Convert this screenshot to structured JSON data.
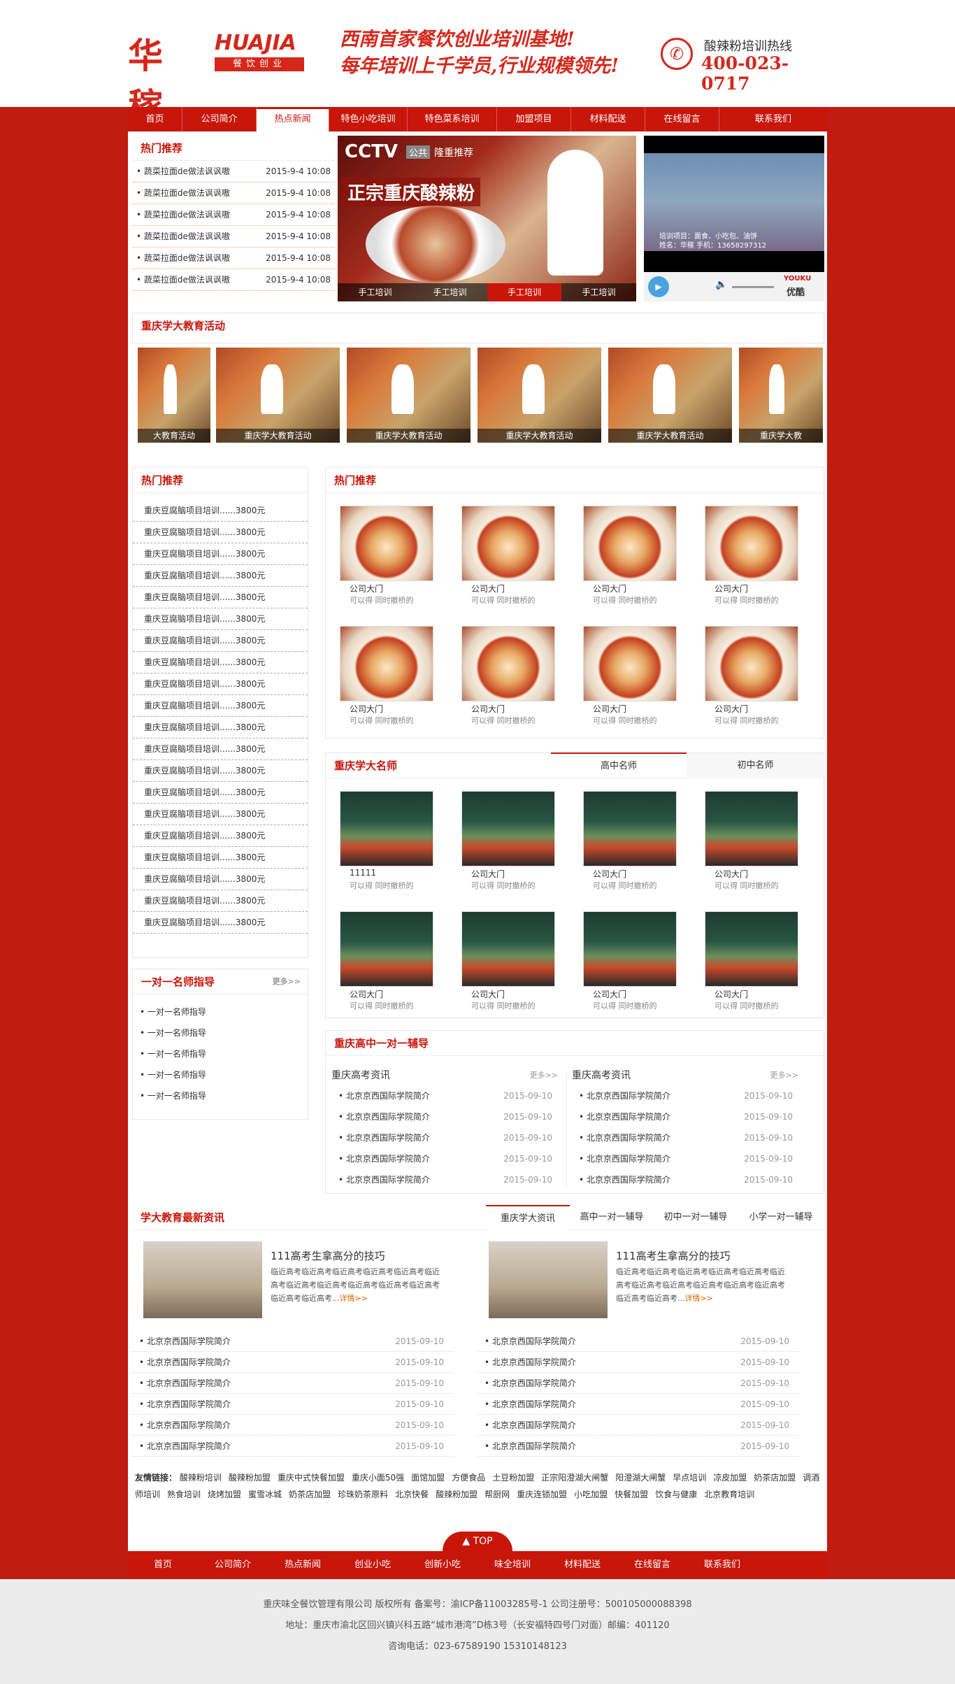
{
  "header": {
    "logo_cn": "华稼",
    "logo_en": "HUAJIA",
    "logo_tag": "餐饮创业",
    "slogan_line1": "西南首家餐饮创业培训基地!",
    "slogan_line2": "每年培训上千学员,行业规模领先!",
    "hotline_label": "酸辣粉培训热线",
    "hotline_number": "400-023-0717"
  },
  "nav": [
    "首页",
    "公司简介",
    "热点新闻",
    "特色小吃培训",
    "特色菜系培训",
    "加盟项目",
    "材料配送",
    "在线留言",
    "联系我们"
  ],
  "hot_recommend_top": {
    "title": "热门推荐",
    "items": [
      {
        "text": "蔬菜拉面de做法讽讽嗷",
        "date": "2015-9-4 10:08"
      },
      {
        "text": "蔬菜拉面de做法讽讽嗷",
        "date": "2015-9-4 10:08"
      },
      {
        "text": "蔬菜拉面de做法讽讽嗷",
        "date": "2015-9-4 10:08"
      },
      {
        "text": "蔬菜拉面de做法讽讽嗷",
        "date": "2015-9-4 10:08"
      },
      {
        "text": "蔬菜拉面de做法讽讽嗷",
        "date": "2015-9-4 10:08"
      },
      {
        "text": "蔬菜拉面de做法讽讽嗷",
        "date": "2015-9-4 10:08"
      }
    ]
  },
  "banner": {
    "cctv": "CCTV",
    "gong": "公共",
    "recommend": "隆重推荐",
    "headline": "正宗重庆酸辣粉",
    "tabs": [
      "手工培训",
      "手工培训",
      "手工培训",
      "手工培训"
    ]
  },
  "video": {
    "line1": "培训项目：面食、小吃包、油饼",
    "line2": "姓名：华稼  手机：13658297312",
    "brand": "YOUKU",
    "brand_cn": "优酷"
  },
  "activity": {
    "title": "重庆学大教育活动",
    "captions": [
      "大教育活动",
      "重庆学大教育活动",
      "重庆学大教育活动",
      "重庆学大教育活动",
      "重庆学大教育活动",
      "重庆学大教"
    ]
  },
  "hot_list_left": {
    "title": "热门推荐",
    "items": [
      "重庆豆腐脑项目培训......3800元",
      "重庆豆腐脑项目培训......3800元",
      "重庆豆腐脑项目培训......3800元",
      "重庆豆腐脑项目培训......3800元",
      "重庆豆腐脑项目培训......3800元",
      "重庆豆腐脑项目培训......3800元",
      "重庆豆腐脑项目培训......3800元",
      "重庆豆腐脑项目培训......3800元",
      "重庆豆腐脑项目培训......3800元",
      "重庆豆腐脑项目培训......3800元",
      "重庆豆腐脑项目培训......3800元",
      "重庆豆腐脑项目培训......3800元",
      "重庆豆腐脑项目培训......3800元",
      "重庆豆腐脑项目培训......3800元",
      "重庆豆腐脑项目培训......3800元",
      "重庆豆腐脑项目培训......3800元",
      "重庆豆腐脑项目培训......3800元",
      "重庆豆腐脑项目培训......3800元",
      "重庆豆腐脑项目培训......3800元",
      "重庆豆腐脑项目培训......3800元"
    ]
  },
  "mentor_box": {
    "title": "一对一名师指导",
    "more": "更多>>",
    "items": [
      "一对一名师指导",
      "一对一名师指导",
      "一对一名师指导",
      "一对一名师指导",
      "一对一名师指导"
    ]
  },
  "hot_grid": {
    "title": "热门推荐",
    "items": [
      {
        "name": "公司大门",
        "desc": "可以得 同时撤桥的"
      },
      {
        "name": "公司大门",
        "desc": "可以得 同时撤桥的"
      },
      {
        "name": "公司大门",
        "desc": "可以得 同时撤桥的"
      },
      {
        "name": "公司大门",
        "desc": "可以得 同时撤桥的"
      },
      {
        "name": "公司大门",
        "desc": "可以得 同时撤桥的"
      },
      {
        "name": "公司大门",
        "desc": "可以得 同时撤桥的"
      },
      {
        "name": "公司大门",
        "desc": "可以得 同时撤桥的"
      },
      {
        "name": "公司大门",
        "desc": "可以得 同时撤桥的"
      }
    ]
  },
  "teachers": {
    "title": "重庆学大名师",
    "tabs": [
      "高中名师",
      "初中名师"
    ],
    "items": [
      {
        "name": "11111",
        "desc": "可以得 同时撤桥的"
      },
      {
        "name": "公司大门",
        "desc": "可以得 同时撤桥的"
      },
      {
        "name": "公司大门",
        "desc": "可以得 同时撤桥的"
      },
      {
        "name": "公司大门",
        "desc": "可以得 同时撤桥的"
      },
      {
        "name": "公司大门",
        "desc": "可以得 同时撤桥的"
      },
      {
        "name": "公司大门",
        "desc": "可以得 同时撤桥的"
      },
      {
        "name": "公司大门",
        "desc": "可以得 同时撤桥的"
      },
      {
        "name": "公司大门",
        "desc": "可以得 同时撤桥的"
      }
    ]
  },
  "tutoring": {
    "title": "重庆高中一对一辅导",
    "col_title": "重庆高考资讯",
    "more": "更多>>",
    "items": [
      {
        "text": "北京京西国际学院简介",
        "date": "2015-09-10"
      },
      {
        "text": "北京京西国际学院简介",
        "date": "2015-09-10"
      },
      {
        "text": "北京京西国际学院简介",
        "date": "2015-09-10"
      },
      {
        "text": "北京京西国际学院简介",
        "date": "2015-09-10"
      },
      {
        "text": "北京京西国际学院简介",
        "date": "2015-09-10"
      }
    ]
  },
  "latest": {
    "title": "学大教育最新资讯",
    "tabs": [
      "重庆学大资讯",
      "高中一对一辅导",
      "初中一对一辅导",
      "小学一对一辅导"
    ],
    "feature_title": "111高考生拿高分的技巧",
    "feature_text": "临近高考临近高考临近高考临近高考临近高考临近高考临近高考临近高考临近高考临近高考临近高考临近高考临近高考...",
    "feature_more": "详情>>",
    "items": [
      {
        "text": "北京京西国际学院简介",
        "date": "2015-09-10"
      },
      {
        "text": "北京京西国际学院简介",
        "date": "2015-09-10"
      },
      {
        "text": "北京京西国际学院简介",
        "date": "2015-09-10"
      },
      {
        "text": "北京京西国际学院简介",
        "date": "2015-09-10"
      },
      {
        "text": "北京京西国际学院简介",
        "date": "2015-09-10"
      },
      {
        "text": "北京京西国际学院简介",
        "date": "2015-09-10"
      }
    ]
  },
  "links": {
    "label": "友情链接：",
    "items": [
      "酸辣粉培训",
      "酸辣粉加盟",
      "重庆中式快餐加盟",
      "重庆小面50强",
      "面馆加盟",
      "方便食品",
      "土豆粉加盟",
      "正宗阳澄湖大闸蟹",
      "阳澄湖大闸蟹",
      "早点培训",
      "凉皮加盟",
      "奶茶店加盟",
      "调酒师培训",
      "熟食培训",
      "烧烤加盟",
      "蜜雪冰城",
      "奶茶店加盟",
      "珍珠奶茶原料",
      "北京快餐",
      "酸辣粉加盟",
      "帮厨网",
      "重庆连锁加盟",
      "小吃加盟",
      "快餐加盟",
      "饮食与健康",
      "北京教育培训"
    ]
  },
  "top_button": "TOP",
  "footer_nav": [
    "首页",
    "公司简介",
    "热点新闻",
    "创业小吃",
    "创新小吃",
    "味全培训",
    "材料配送",
    "在线留言",
    "联系我们"
  ],
  "copyright": {
    "line1": "重庆味全餐饮管理有限公司 版权所有 备案号：渝ICP备11003285号-1 公司注册号：500105000088398",
    "line2": "地址：重庆市渝北区回兴镇兴科五路“城市港湾”D栋3号（长安福特四号门对面）邮编：401120",
    "line3": "咨询电话：023-67589190 15310148123"
  },
  "colors": {
    "brand": "#c8160a",
    "accent_text": "#d5271b"
  }
}
